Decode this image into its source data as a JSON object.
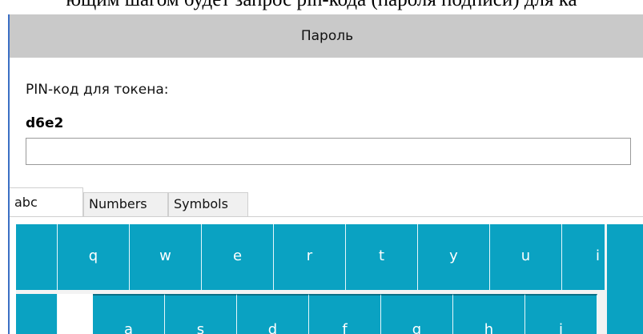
{
  "background_caption": "ющим шагом будет запрос pin-кода (пароля подписи) для ка",
  "dialog": {
    "title": "Пароль",
    "pin_label": "PIN-код для токена:",
    "token_id": "d6e2",
    "pin_value": ""
  },
  "tabs": [
    {
      "label": "abc",
      "active": true
    },
    {
      "label": "Numbers",
      "active": false
    },
    {
      "label": "Symbols",
      "active": false
    }
  ],
  "keyboard": {
    "key_color": "#0aa2c2",
    "row1": [
      "q",
      "w",
      "e",
      "r",
      "t",
      "y",
      "u",
      "i"
    ],
    "row2": [
      "a",
      "s",
      "d",
      "f",
      "g",
      "h",
      "j"
    ]
  }
}
